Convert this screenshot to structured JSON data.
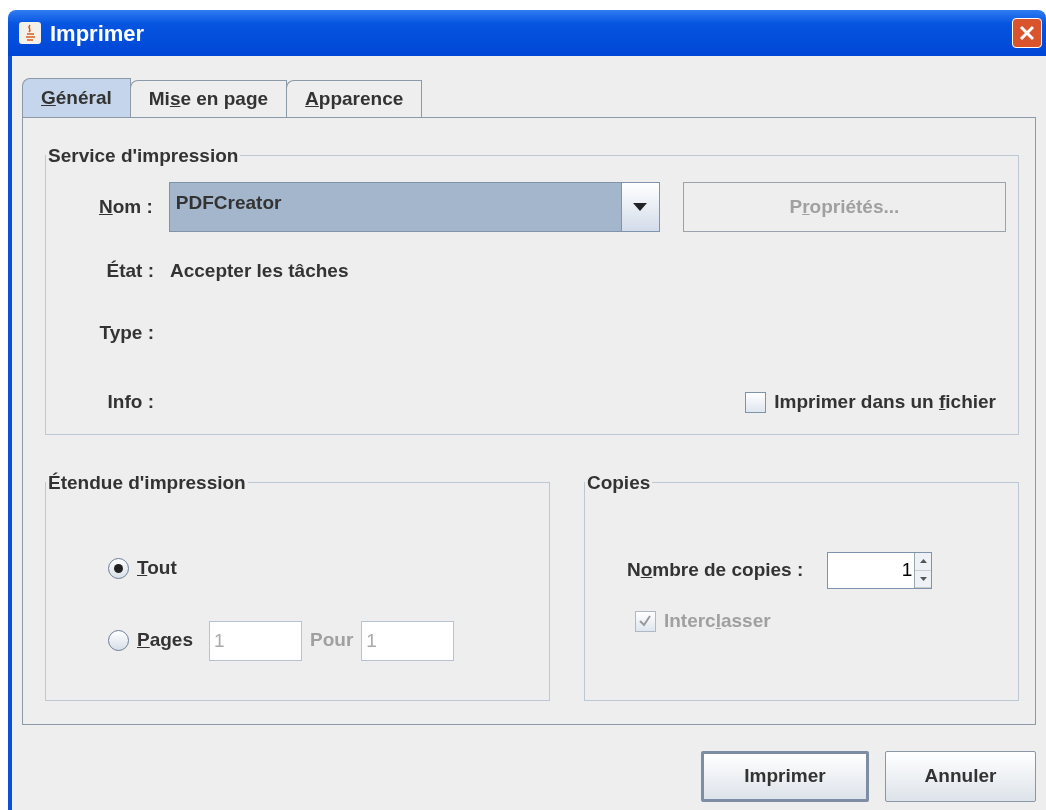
{
  "window": {
    "title": "Imprimer"
  },
  "tabs": [
    {
      "label": {
        "key": "G",
        "post": "énéral"
      },
      "selected": true
    },
    {
      "label": {
        "pre": "Mi",
        "key": "s",
        "post": "e en page"
      },
      "selected": false
    },
    {
      "label": {
        "key": "A",
        "post": "pparence"
      },
      "selected": false
    }
  ],
  "service": {
    "title": "Service d'impression",
    "name_label": {
      "key": "N",
      "post": "om :"
    },
    "printer": "PDFCreator",
    "properties_button": {
      "label": {
        "pre": "P",
        "key": "r",
        "post": "opriétés..."
      },
      "disabled": true
    },
    "status_label": "État :",
    "status": "Accepter les tâches",
    "type_label": "Type :",
    "info_label": "Info :",
    "print_to_file": {
      "label": {
        "pre": "Imprimer dans un ",
        "key": "f",
        "post": "ichier"
      },
      "checked": false
    }
  },
  "range": {
    "title": "Étendue d'impression",
    "options": [
      {
        "kind": "all",
        "label": {
          "key": "T",
          "post": "out"
        },
        "selected": true
      },
      {
        "kind": "pages",
        "label": {
          "key": "P",
          "post": "ages"
        },
        "selected": false,
        "from": "1",
        "to_label": "Pour",
        "to": "1",
        "disabled": true
      }
    ]
  },
  "copies": {
    "title": "Copies",
    "count_label": {
      "pre": "N",
      "key": "o",
      "post": "mbre de copies :"
    },
    "count": "1",
    "collate": {
      "label": {
        "pre": "Interc",
        "key": "l",
        "post": "asser"
      },
      "checked": true,
      "disabled": true
    }
  },
  "buttons": [
    {
      "label": "Imprimer",
      "default": true
    },
    {
      "label": "Annuler",
      "default": false
    }
  ]
}
